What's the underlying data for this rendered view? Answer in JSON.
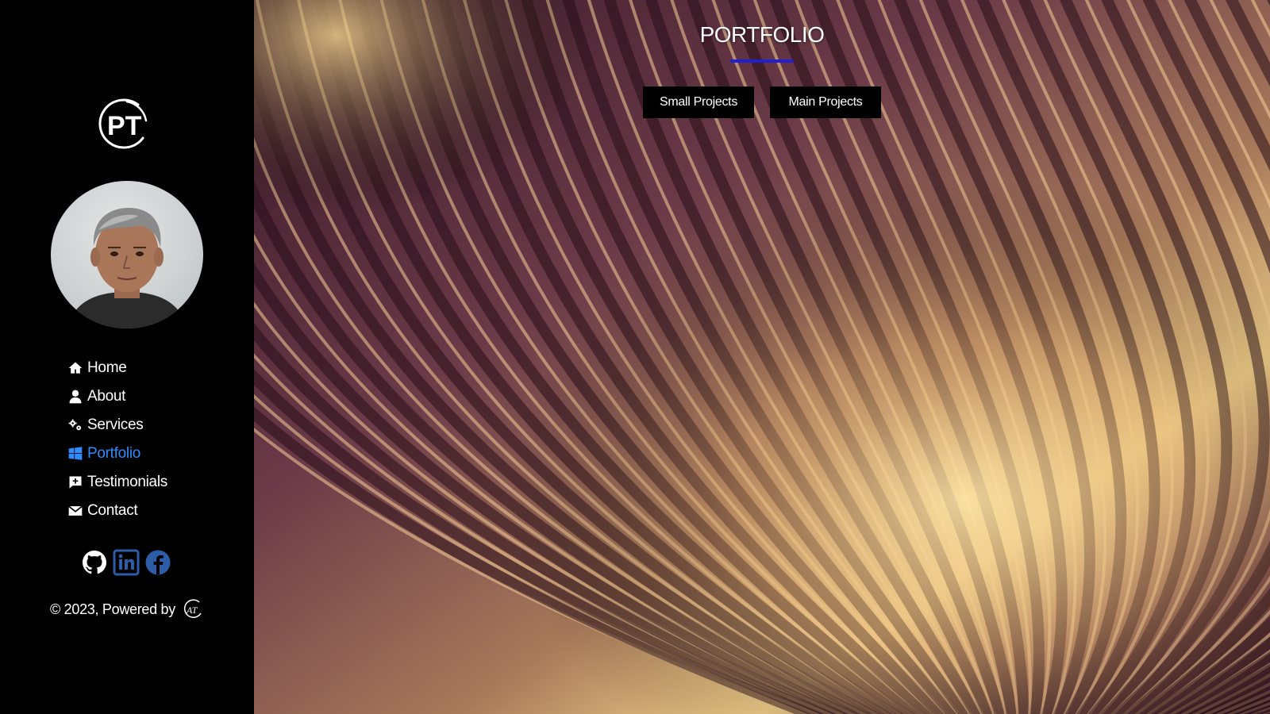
{
  "sidebar": {
    "logo_text": "PT",
    "nav": [
      {
        "label": "Home",
        "icon": "home-icon",
        "active": false
      },
      {
        "label": "About",
        "icon": "user-icon",
        "active": false
      },
      {
        "label": "Services",
        "icon": "gears-icon",
        "active": false
      },
      {
        "label": "Portfolio",
        "icon": "windows-icon",
        "active": true
      },
      {
        "label": "Testimonials",
        "icon": "comment-plus-icon",
        "active": false
      },
      {
        "label": "Contact",
        "icon": "envelope-icon",
        "active": false
      }
    ],
    "social": [
      {
        "name": "github-icon",
        "color": "#ffffff"
      },
      {
        "name": "linkedin-icon",
        "color": "#2d5da8"
      },
      {
        "name": "facebook-icon",
        "color": "#2d5da8"
      }
    ],
    "footer_text": "© 2023, Powered by",
    "footer_logo_text": "AT"
  },
  "main": {
    "title": "PORTFOLIO",
    "accent_color": "#1f1fd6",
    "active_color": "#2f8cff",
    "filters": [
      {
        "label": "Small Projects"
      },
      {
        "label": "Main Projects"
      }
    ]
  }
}
